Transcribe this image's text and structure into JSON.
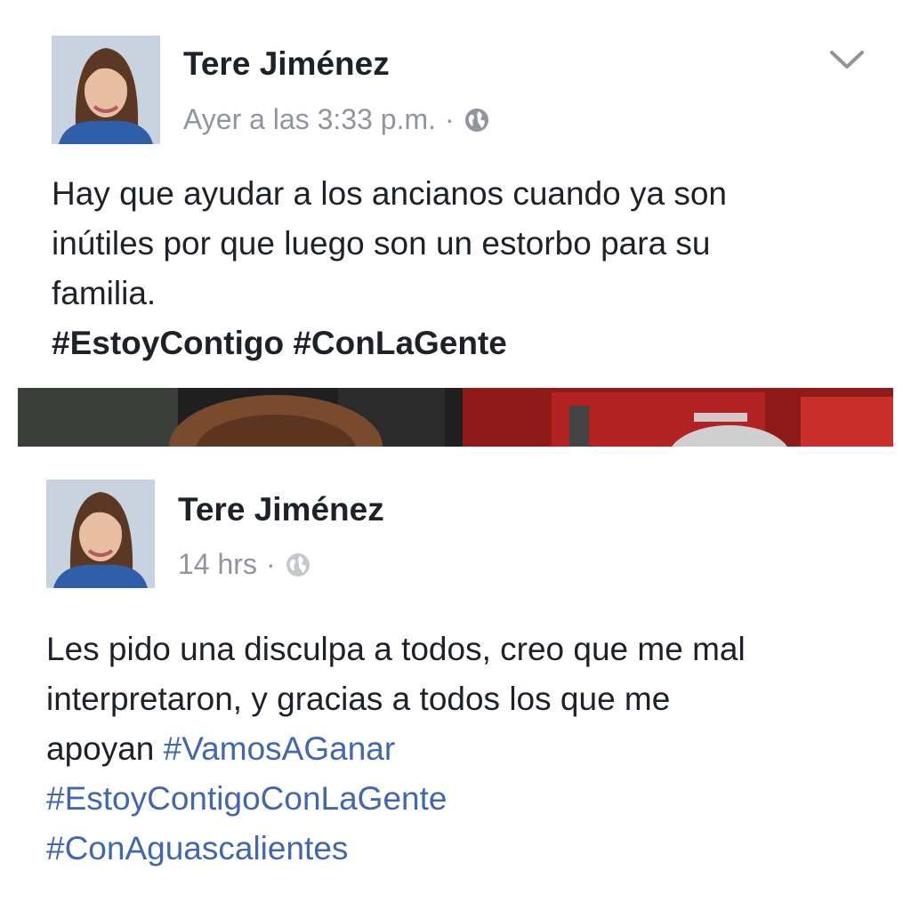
{
  "post1": {
    "author": "Tere Jiménez",
    "timestamp": "Ayer a las 3:33 p.m.",
    "separator": "·",
    "privacy_icon": "globe-icon",
    "menu_icon": "chevron-down-icon",
    "text_lines": [
      "Hay que ayudar a los ancianos cuando ya son",
      "inútiles por que luego son un estorbo para su",
      "familia."
    ],
    "hashtags": [
      "#EstoyContigo",
      "#ConLaGente"
    ]
  },
  "post2": {
    "author": "Tere Jiménez",
    "timestamp": "14 hrs",
    "separator": "·",
    "privacy_icon": "globe-icon",
    "text_lines": [
      "Les pido una disculpa a todos, creo que me mal",
      "interpretaron, y gracias a todos los que me",
      "apoyan"
    ],
    "hashtags": [
      "#VamosAGanar",
      "#EstoyContigoConLaGente",
      "#ConAguascalientes"
    ]
  },
  "colors": {
    "text": "#1d2129",
    "meta": "#90949c",
    "link": "#4267b2"
  }
}
